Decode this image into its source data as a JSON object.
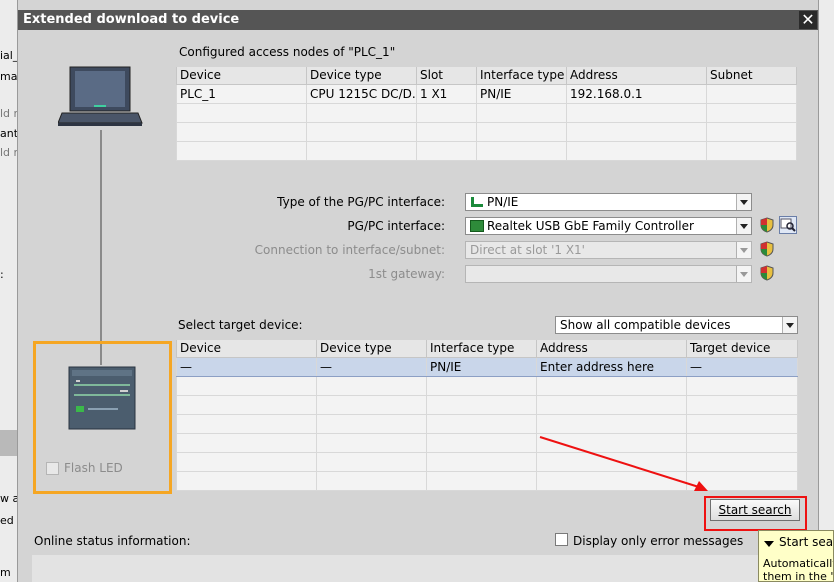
{
  "background": {
    "left_fragments": [
      "ial_",
      "ma",
      "ld n",
      "ant",
      "ld n",
      ":",
      "w a",
      "ed",
      "m"
    ],
    "right_fragments": []
  },
  "dialog": {
    "title": "Extended download to device",
    "close_glyph": "✕"
  },
  "configured_nodes": {
    "label": "Configured access nodes of \"PLC_1\"",
    "columns": [
      "Device",
      "Device type",
      "Slot",
      "Interface type",
      "Address",
      "Subnet"
    ],
    "rows": [
      [
        "PLC_1",
        "CPU 1215C DC/D...",
        "1 X1",
        "PN/IE",
        "192.168.0.1",
        ""
      ],
      [
        "",
        "",
        "",
        "",
        "",
        ""
      ],
      [
        "",
        "",
        "",
        "",
        "",
        ""
      ],
      [
        "",
        "",
        "",
        "",
        "",
        ""
      ]
    ]
  },
  "interface": {
    "type_label": "Type of the PG/PC interface:",
    "type_value": "PN/IE",
    "pgpc_label": "PG/PC interface:",
    "pgpc_value": "Realtek USB GbE Family Controller",
    "connection_label": "Connection to interface/subnet:",
    "connection_value": "Direct at slot '1 X1'",
    "gateway_label": "1st gateway:",
    "gateway_value": ""
  },
  "target": {
    "label": "Select target device:",
    "filter_value": "Show all compatible devices",
    "columns": [
      "Device",
      "Device type",
      "Interface type",
      "Address",
      "Target device"
    ],
    "rows": [
      [
        "—",
        "—",
        "PN/IE",
        "Enter address here",
        "—"
      ],
      [
        "",
        "",
        "",
        "",
        ""
      ],
      [
        "",
        "",
        "",
        "",
        ""
      ],
      [
        "",
        "",
        "",
        "",
        ""
      ],
      [
        "",
        "",
        "",
        "",
        ""
      ],
      [
        "",
        "",
        "",
        "",
        ""
      ],
      [
        "",
        "",
        "",
        "",
        ""
      ]
    ]
  },
  "device_panel": {
    "flash_led_label": "Flash LED"
  },
  "start_search_label": "Start search",
  "online_status_label": "Online status information:",
  "display_errors_label": "Display only error messages",
  "tooltip": {
    "title": "Start searc",
    "body_line1": "Automatically",
    "body_line2": "them in the \""
  },
  "colors": {
    "title_bar": "#555555",
    "highlight_box": "#f5a623",
    "annotation_red": "#e11111",
    "selected_row": "#c9d6ea"
  }
}
